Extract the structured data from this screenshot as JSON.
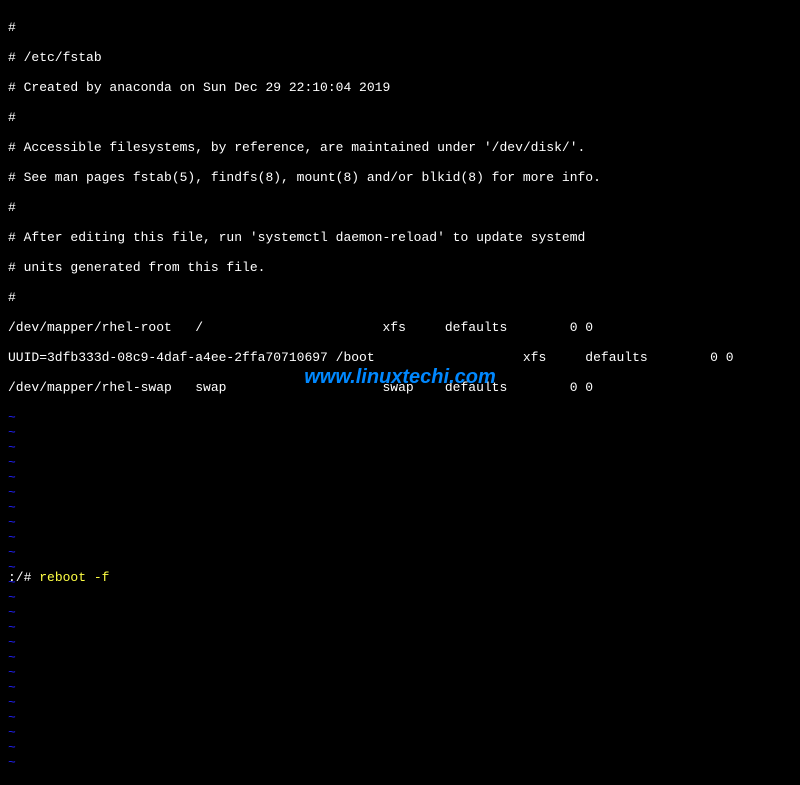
{
  "file": {
    "comments": [
      "#",
      "# /etc/fstab",
      "# Created by anaconda on Sun Dec 29 22:10:04 2019",
      "#",
      "# Accessible filesystems, by reference, are maintained under '/dev/disk/'.",
      "# See man pages fstab(5), findfs(8), mount(8) and/or blkid(8) for more info.",
      "#",
      "# After editing this file, run 'systemctl daemon-reload' to update systemd",
      "# units generated from this file.",
      "#"
    ],
    "entries": [
      "/dev/mapper/rhel-root   /                       xfs     defaults        0 0",
      "UUID=3dfb333d-08c9-4daf-a4ee-2ffa70710697 /boot                   xfs     defaults        0 0",
      "/dev/mapper/rhel-swap   swap                    swap    defaults        0 0"
    ]
  },
  "editor": {
    "tilde": "~",
    "tilde_count": 24
  },
  "watermark": {
    "text": "www.linuxtechi.com"
  },
  "statusbar": {
    "path": ":/# ",
    "command": "reboot -f"
  }
}
